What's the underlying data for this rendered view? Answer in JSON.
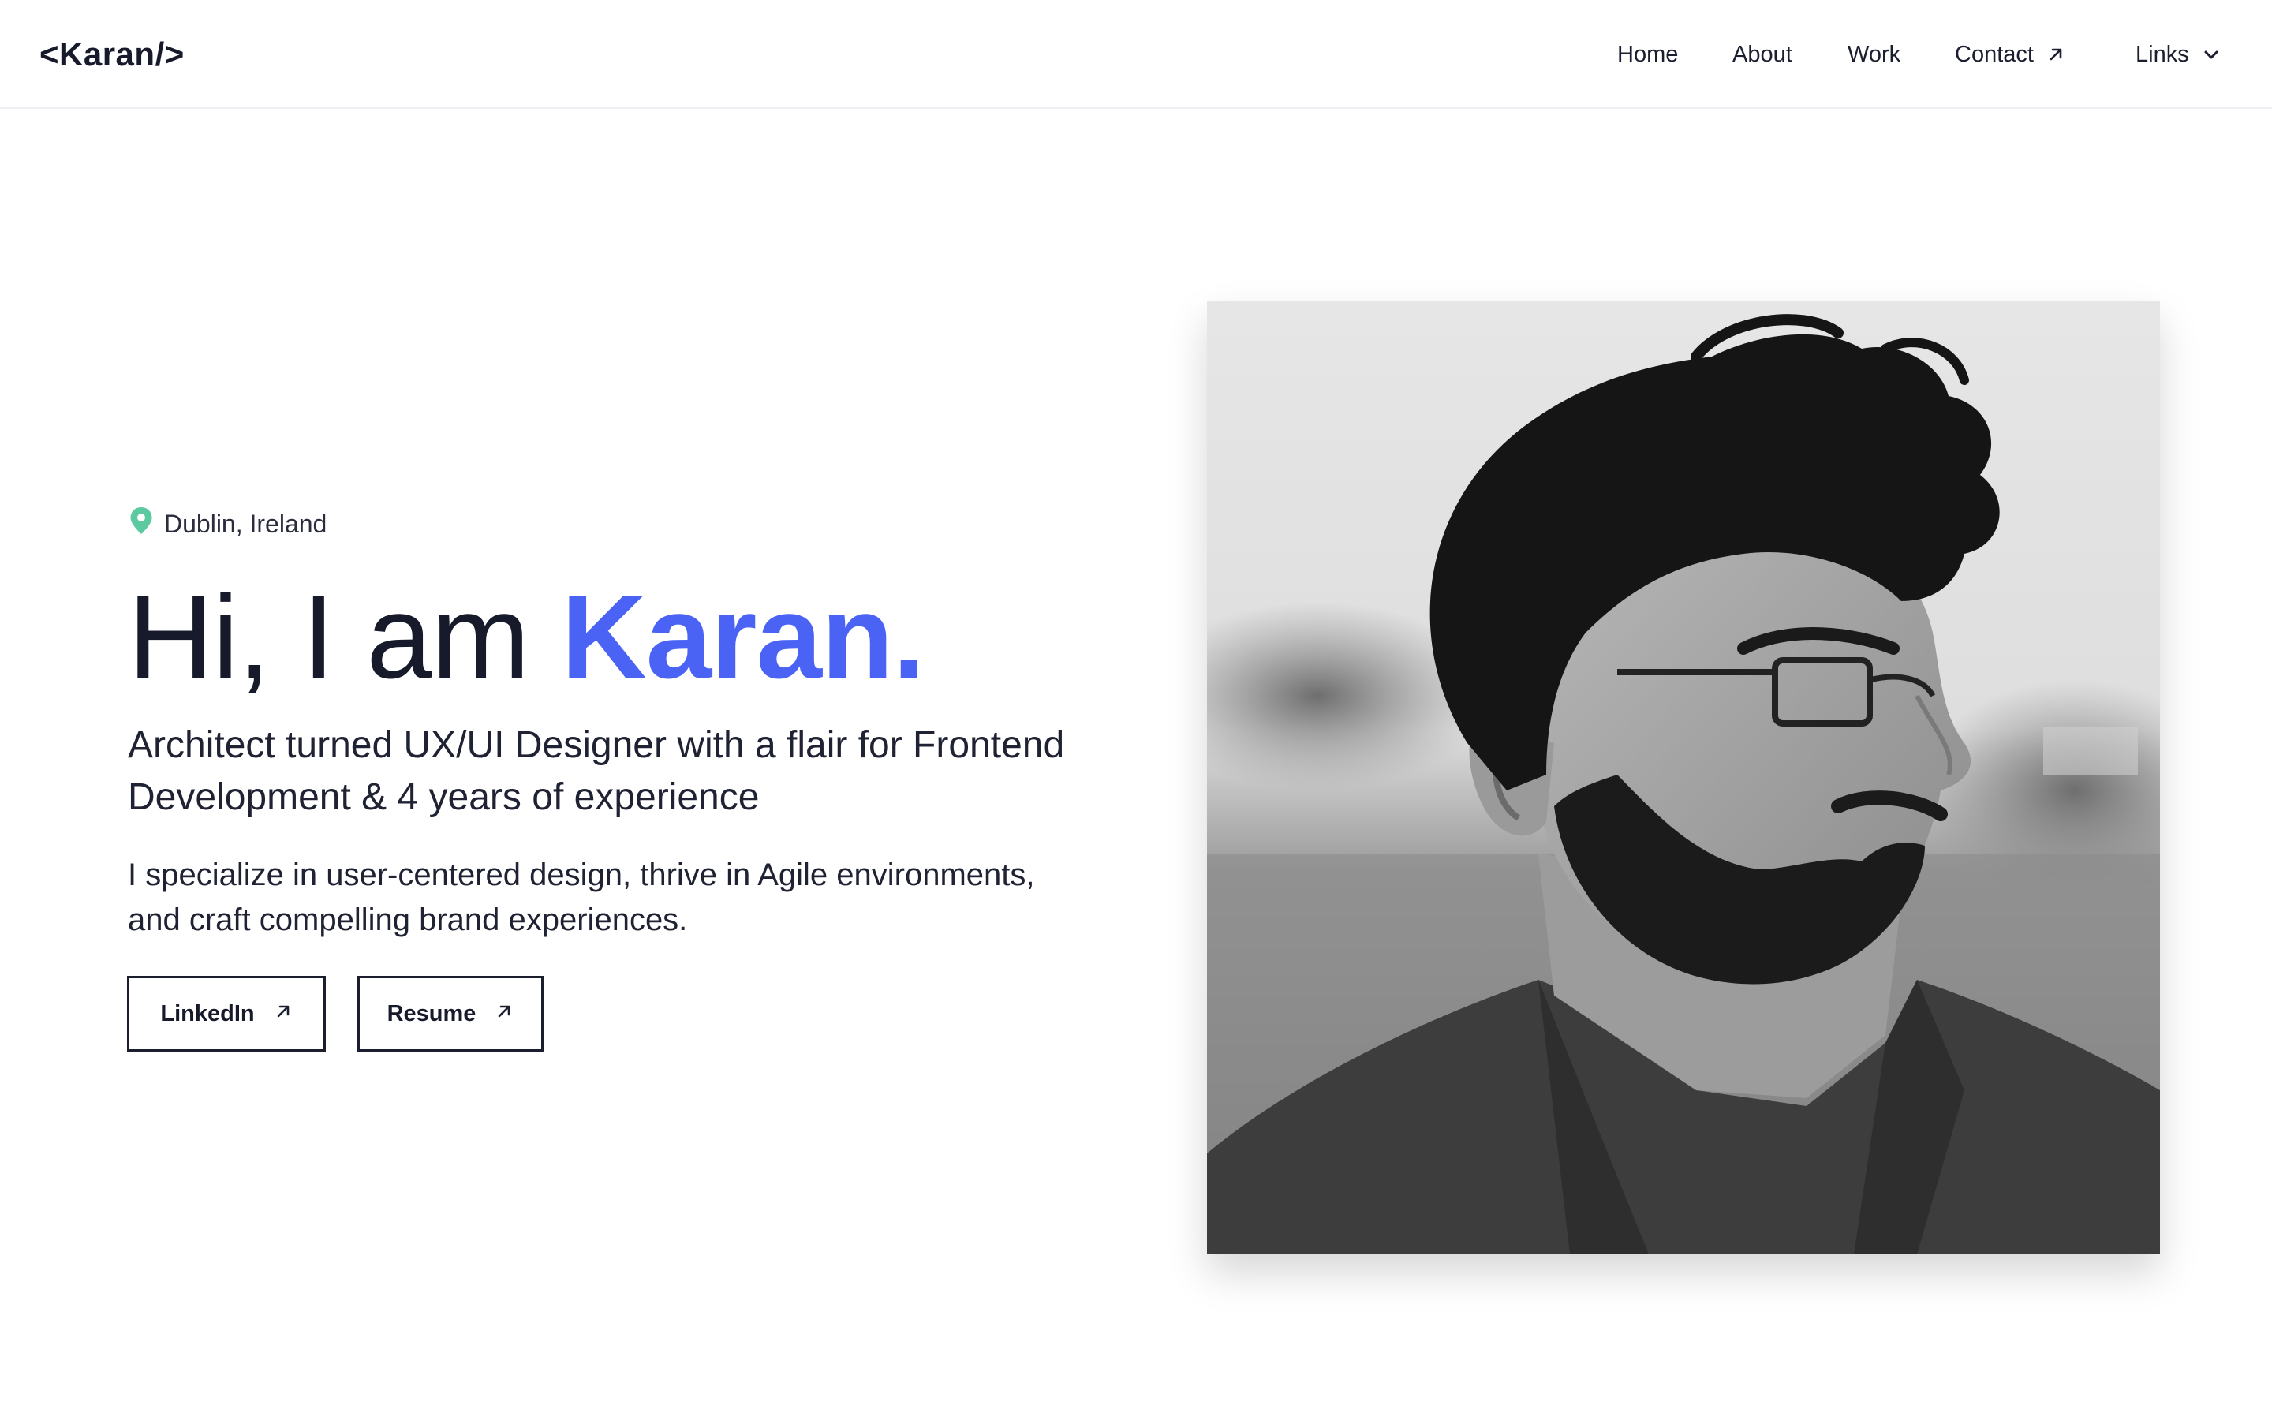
{
  "header": {
    "logo": "<Karan/>",
    "nav": [
      {
        "label": "Home"
      },
      {
        "label": "About"
      },
      {
        "label": "Work"
      },
      {
        "label": "Contact",
        "icon": "arrow-up-right-icon"
      },
      {
        "label": "Links",
        "icon": "chevron-down-icon"
      }
    ]
  },
  "hero": {
    "location": "Dublin, Ireland",
    "location_icon": "map-pin-icon",
    "greeting": "Hi, I am ",
    "name": "Karan.",
    "subheading": "Architect turned UX/UI Designer with a flair for Frontend Development & 4 years of experience",
    "description": "I specialize in user-centered design, thrive in Agile environments, and craft compelling brand experiences.",
    "buttons": [
      {
        "label": "LinkedIn",
        "icon": "arrow-up-right-icon"
      },
      {
        "label": "Resume",
        "icon": "arrow-up-right-icon"
      }
    ]
  },
  "portrait": {
    "description_style": "grayscale",
    "alt": "Portrait photo"
  },
  "colors": {
    "accent": "#4a63f5",
    "text": "#171a2b",
    "pin": "#5cc9a0",
    "border": "#1b1e2e"
  }
}
